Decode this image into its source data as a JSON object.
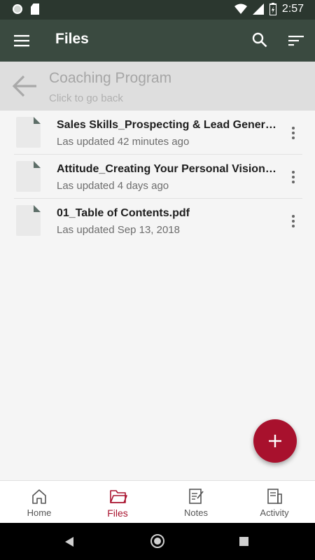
{
  "status_bar": {
    "time": "2:57"
  },
  "app_bar": {
    "title": "Files"
  },
  "folder": {
    "title": "Coaching Program",
    "subtitle": "Click to go back"
  },
  "files": [
    {
      "name": "Sales Skills_Prospecting & Lead Generation.pdf",
      "updated": "Las updated 42 minutes ago"
    },
    {
      "name": "Attitude_Creating Your Personal Vision.pdf",
      "updated": "Las updated 4 days ago"
    },
    {
      "name": "01_Table of Contents.pdf",
      "updated": "Las updated Sep 13, 2018"
    }
  ],
  "bottom_nav": {
    "items": [
      {
        "label": "Home",
        "icon": "home-icon"
      },
      {
        "label": "Files",
        "icon": "folder-icon",
        "active": true
      },
      {
        "label": "Notes",
        "icon": "notes-icon"
      },
      {
        "label": "Activity",
        "icon": "activity-icon"
      }
    ]
  },
  "colors": {
    "app_bar": "#3a4a40",
    "status_bar": "#2b372f",
    "accent": "#a8112d",
    "header_bg": "#dedede"
  }
}
